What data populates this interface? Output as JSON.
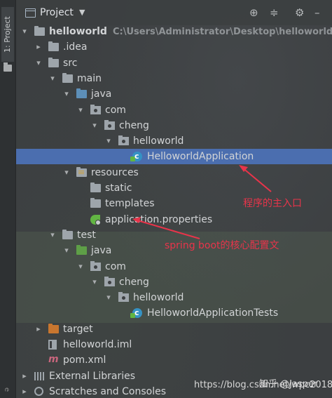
{
  "sidebar": {
    "tab_label": "1: Project",
    "bottom_label": "e"
  },
  "header": {
    "title": "Project",
    "buttons": [
      "globe-icon",
      "collapse-icon",
      "gear-icon",
      "minimize-icon"
    ]
  },
  "tree": [
    {
      "label": "helloworld",
      "sub": "C:\\Users\\Administrator\\Desktop\\helloworld",
      "arrow": "▾",
      "icon": "folder",
      "depth": 0,
      "bold": true
    },
    {
      "label": ".idea",
      "arrow": "▸",
      "icon": "folder",
      "depth": 1
    },
    {
      "label": "src",
      "arrow": "▾",
      "icon": "folder",
      "depth": 1
    },
    {
      "label": "main",
      "arrow": "▾",
      "icon": "folder",
      "depth": 2
    },
    {
      "label": "java",
      "arrow": "▾",
      "icon": "folder blue",
      "depth": 3
    },
    {
      "label": "com",
      "arrow": "▾",
      "icon": "pkg",
      "depth": 4
    },
    {
      "label": "cheng",
      "arrow": "▾",
      "icon": "pkg",
      "depth": 5
    },
    {
      "label": "helloworld",
      "arrow": "▾",
      "icon": "pkg",
      "depth": 6
    },
    {
      "label": "HelloworldApplication",
      "arrow": "",
      "icon": "javaclass",
      "depth": 7,
      "selected": true
    },
    {
      "label": "resources",
      "arrow": "▾",
      "icon": "folder res",
      "depth": 3
    },
    {
      "label": "static",
      "arrow": "",
      "icon": "folder",
      "depth": 4
    },
    {
      "label": "templates",
      "arrow": "",
      "icon": "folder",
      "depth": 4
    },
    {
      "label": "application.properties",
      "arrow": "",
      "icon": "spring",
      "depth": 4
    },
    {
      "label": "test",
      "arrow": "▾",
      "icon": "folder",
      "depth": 2
    },
    {
      "label": "java",
      "arrow": "▾",
      "icon": "folder green",
      "depth": 3
    },
    {
      "label": "com",
      "arrow": "▾",
      "icon": "pkg",
      "depth": 4
    },
    {
      "label": "cheng",
      "arrow": "▾",
      "icon": "pkg",
      "depth": 5
    },
    {
      "label": "helloworld",
      "arrow": "▾",
      "icon": "pkg",
      "depth": 6
    },
    {
      "label": "HelloworldApplicationTests",
      "arrow": "",
      "icon": "javaclass",
      "depth": 7
    },
    {
      "label": "target",
      "arrow": "▸",
      "icon": "folder orange",
      "depth": 1
    },
    {
      "label": "helloworld.iml",
      "arrow": "",
      "icon": "iml",
      "depth": 1
    },
    {
      "label": "pom.xml",
      "arrow": "",
      "icon": "maven",
      "depth": 1
    },
    {
      "label": "External Libraries",
      "arrow": "▸",
      "icon": "libs",
      "depth": 0
    },
    {
      "label": "Scratches and Consoles",
      "arrow": "▸",
      "icon": "scratch",
      "depth": 0
    }
  ],
  "annotations": {
    "main_entry": "程序的主入口",
    "config_file": "spring boot的核心配置文"
  },
  "watermark": {
    "zhihu": "知乎 @Jasper",
    "url": "https://blog.csdn.net/wpc2018"
  },
  "colors": {
    "selection": "#4b6eaf",
    "annotation": "#e8344a"
  }
}
